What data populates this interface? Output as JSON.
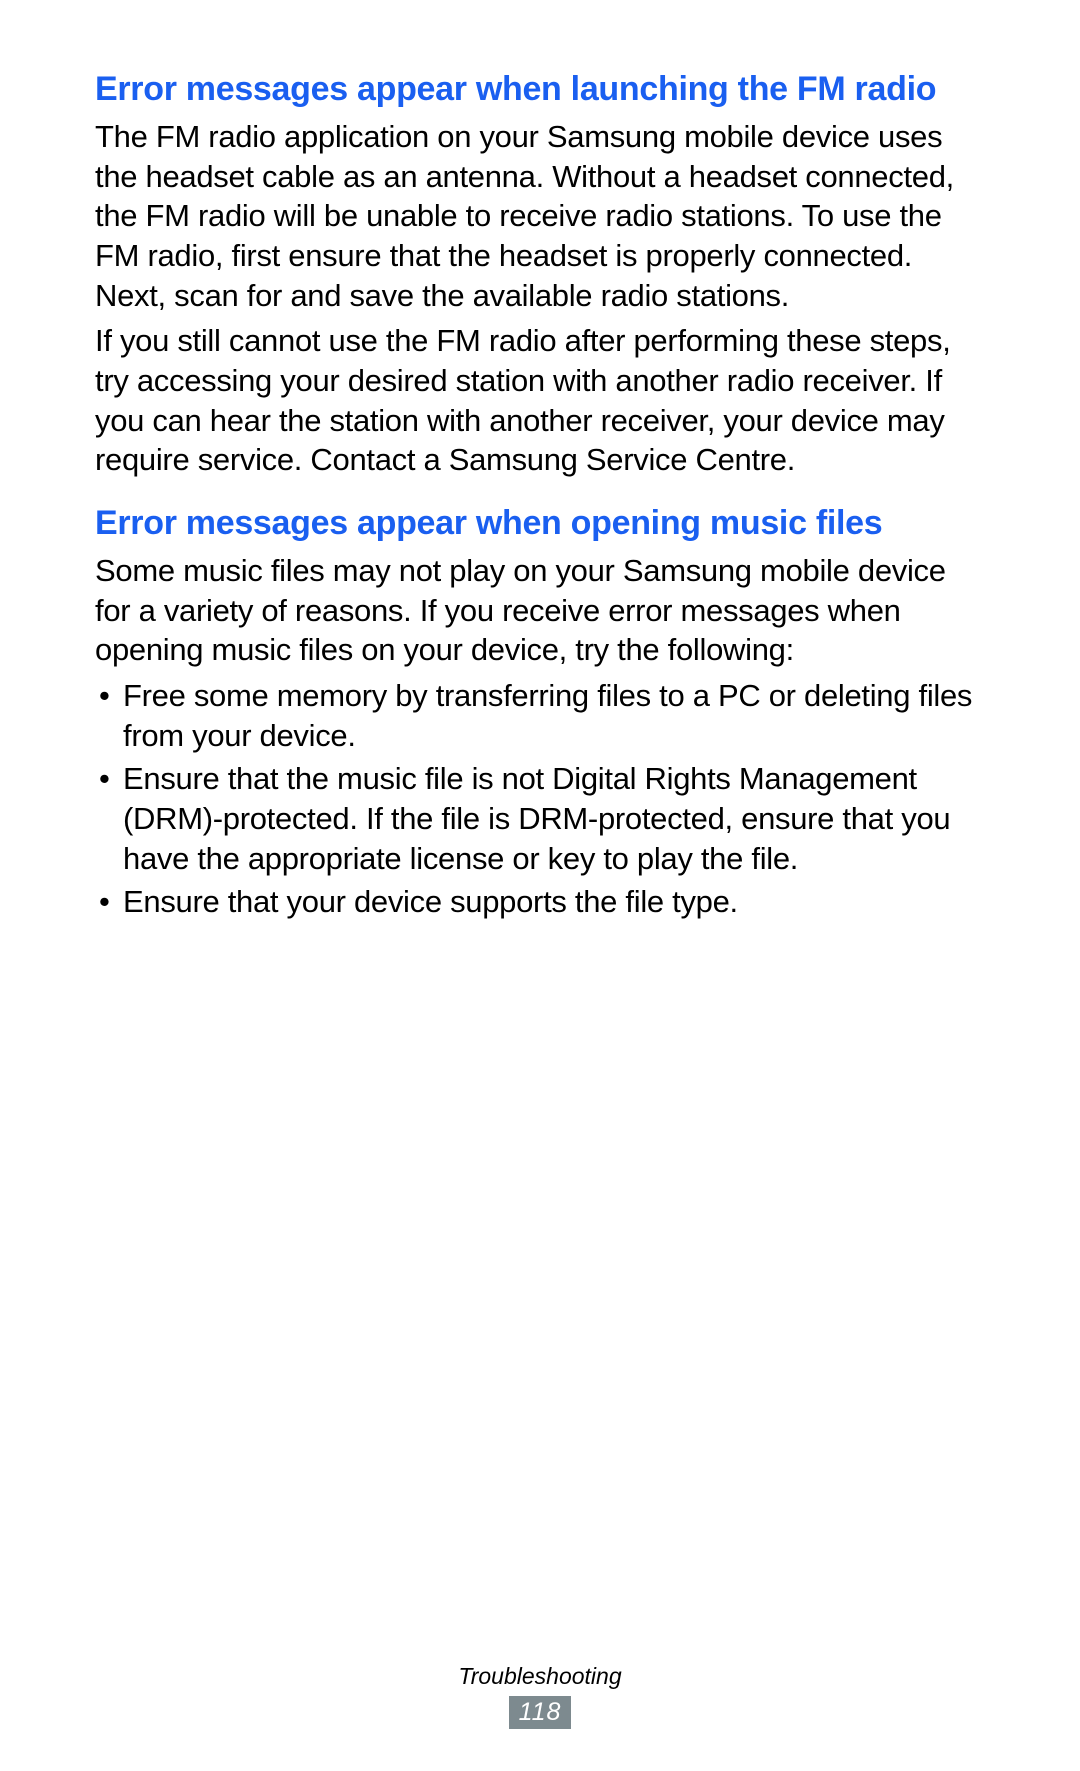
{
  "section1": {
    "heading": "Error messages appear when launching the FM radio",
    "para1": "The FM radio application on your Samsung mobile device uses the headset cable as an antenna. Without a headset connected, the FM radio will be unable to receive radio stations. To use the FM radio, first ensure that the headset is properly connected. Next, scan for and save the available radio stations.",
    "para2": "If you still cannot use the FM radio after performing these steps, try accessing your desired station with another radio receiver. If you can hear the station with another receiver, your device may require service. Contact a Samsung Service Centre."
  },
  "section2": {
    "heading": "Error messages appear when opening music files",
    "para1": "Some music files may not play on your Samsung mobile device for a variety of reasons. If you receive error messages when opening music files on your device, try the following:",
    "bullets": [
      "Free some memory by transferring files to a PC or deleting files from your device.",
      "Ensure that the music file is not Digital Rights Management (DRM)-protected. If the file is DRM-protected, ensure that you have the appropriate license or key to play the file.",
      "Ensure that your device supports the file type."
    ]
  },
  "footer": {
    "label": "Troubleshooting",
    "page": "118"
  }
}
